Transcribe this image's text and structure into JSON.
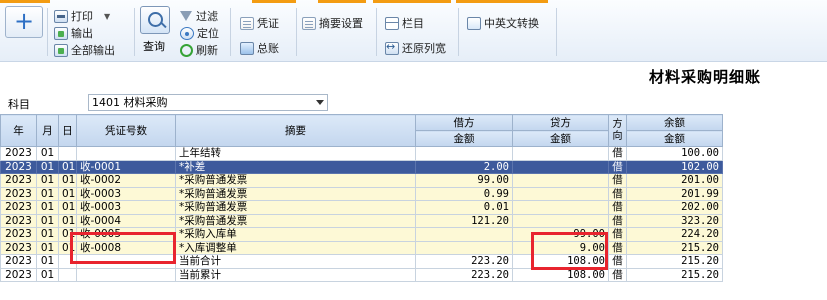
{
  "toolbar": {
    "add_symbol": "+",
    "print_label": "打印",
    "export_label": "输出",
    "export_all_label": "全部输出",
    "query_label": "查询",
    "filter_label": "过滤",
    "locate_label": "定位",
    "refresh_label": "刷新",
    "voucher_label": "凭证",
    "ledger_label": "总账",
    "summary_settings_label": "摘要设置",
    "columns_label": "栏目",
    "restore_width_label": "还原列宽",
    "language_toggle_label": "中英文转换"
  },
  "report": {
    "title": "材料采购明细账",
    "subject_label": "科目",
    "subject_value": "1401 材料采购"
  },
  "table": {
    "headers": {
      "year": "年",
      "month": "月",
      "day": "日",
      "voucher_no": "凭证号数",
      "summary": "摘要",
      "debit": "借方",
      "credit": "贷方",
      "direction": "方向",
      "balance": "余额",
      "amount": "金额"
    },
    "rows": [
      {
        "year": "2023",
        "month": "01",
        "day": "",
        "voucher": "",
        "summary": "上年结转",
        "debit": "",
        "credit": "",
        "dir": "借",
        "balance": "100.00",
        "style": "white"
      },
      {
        "year": "2023",
        "month": "01",
        "day": "01",
        "voucher": "收-0001",
        "summary": "*补差",
        "debit": "2.00",
        "credit": "",
        "dir": "借",
        "balance": "102.00",
        "style": "selected"
      },
      {
        "year": "2023",
        "month": "01",
        "day": "01",
        "voucher": "收-0002",
        "summary": "*采购普通发票",
        "debit": "99.00",
        "credit": "",
        "dir": "借",
        "balance": "201.00",
        "style": "yellow"
      },
      {
        "year": "2023",
        "month": "01",
        "day": "01",
        "voucher": "收-0003",
        "summary": "*采购普通发票",
        "debit": "0.99",
        "credit": "",
        "dir": "借",
        "balance": "201.99",
        "style": "yellow"
      },
      {
        "year": "2023",
        "month": "01",
        "day": "01",
        "voucher": "收-0003",
        "summary": "*采购普通发票",
        "debit": "0.01",
        "credit": "",
        "dir": "借",
        "balance": "202.00",
        "style": "yellow"
      },
      {
        "year": "2023",
        "month": "01",
        "day": "01",
        "voucher": "收-0004",
        "summary": "*采购普通发票",
        "debit": "121.20",
        "credit": "",
        "dir": "借",
        "balance": "323.20",
        "style": "yellow"
      },
      {
        "year": "2023",
        "month": "01",
        "day": "01",
        "voucher": "收-0005",
        "summary": "*采购入库单",
        "debit": "",
        "credit": "99.00",
        "dir": "借",
        "balance": "224.20",
        "style": "yellow"
      },
      {
        "year": "2023",
        "month": "01",
        "day": "01",
        "voucher": "收-0008",
        "summary": "*入库调整单",
        "debit": "",
        "credit": "9.00",
        "dir": "借",
        "balance": "215.20",
        "style": "yellow"
      },
      {
        "year": "2023",
        "month": "01",
        "day": "",
        "voucher": "",
        "summary": "当前合计",
        "debit": "223.20",
        "credit": "108.00",
        "dir": "借",
        "balance": "215.20",
        "style": "white"
      },
      {
        "year": "2023",
        "month": "01",
        "day": "",
        "voucher": "",
        "summary": "当前累计",
        "debit": "223.20",
        "credit": "108.00",
        "dir": "借",
        "balance": "215.20",
        "style": "white"
      }
    ]
  },
  "colors": {
    "accent_bar": "#f39c12",
    "selected_row": "#3d5a9c",
    "highlight_row": "#fdf9d6",
    "annotation_box": "#e8242e"
  },
  "icons": [
    "add-icon",
    "print-icon",
    "export-icon",
    "export-all-icon",
    "search-icon",
    "filter-icon",
    "locate-icon",
    "refresh-icon",
    "voucher-icon",
    "ledger-icon",
    "summary-settings-icon",
    "columns-icon",
    "restore-width-icon",
    "language-icon"
  ]
}
